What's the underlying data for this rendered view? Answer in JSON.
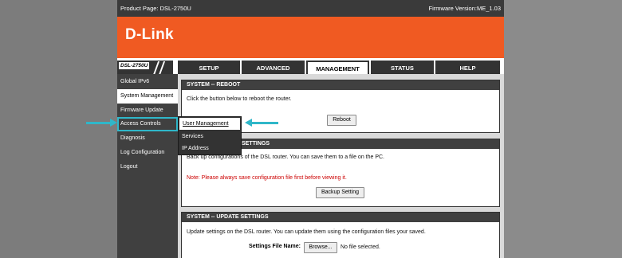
{
  "header": {
    "product_page": "Product Page: DSL-2750U",
    "firmware": "Firmware Version:ME_1.03"
  },
  "brand": {
    "logo": "D-Link"
  },
  "nav": {
    "model": "DSL-2750U",
    "tabs": [
      {
        "label": "SETUP"
      },
      {
        "label": "ADVANCED"
      },
      {
        "label": "MANAGEMENT",
        "active": true
      },
      {
        "label": "STATUS"
      },
      {
        "label": "HELP"
      }
    ]
  },
  "sidebar": {
    "items": [
      {
        "label": "Global IPv6"
      },
      {
        "label": "System Management",
        "selected": true
      },
      {
        "label": "Firmware Update"
      },
      {
        "label": "Access Controls",
        "highlighted": true
      },
      {
        "label": "Diagnosis"
      },
      {
        "label": "Log Configuration"
      },
      {
        "label": "Logout"
      }
    ]
  },
  "flyout": {
    "items": [
      {
        "label": "User Management",
        "hovered": true
      },
      {
        "label": "Services"
      },
      {
        "label": "IP Address"
      }
    ]
  },
  "reboot": {
    "title": "SYSTEM -- REBOOT",
    "text": "Click the button below to reboot the router.",
    "button": "Reboot"
  },
  "backup": {
    "title_suffix": "SETTINGS",
    "text": "Back up configurations of the DSL router. You can save them to a file on the PC.",
    "note": "Note: Please always save configuration file first before viewing it.",
    "button": "Backup Setting"
  },
  "update": {
    "title": "SYSTEM -- UPDATE SETTINGS",
    "text": "Update settings on the DSL router. You can update them using the configuration files your saved.",
    "file_label": "Settings File Name:",
    "browse": "Browse...",
    "file_status": "No file selected."
  },
  "colors": {
    "brand_orange": "#f05a22",
    "annotation_cyan": "#2fb7c9",
    "dark": "#404040"
  }
}
